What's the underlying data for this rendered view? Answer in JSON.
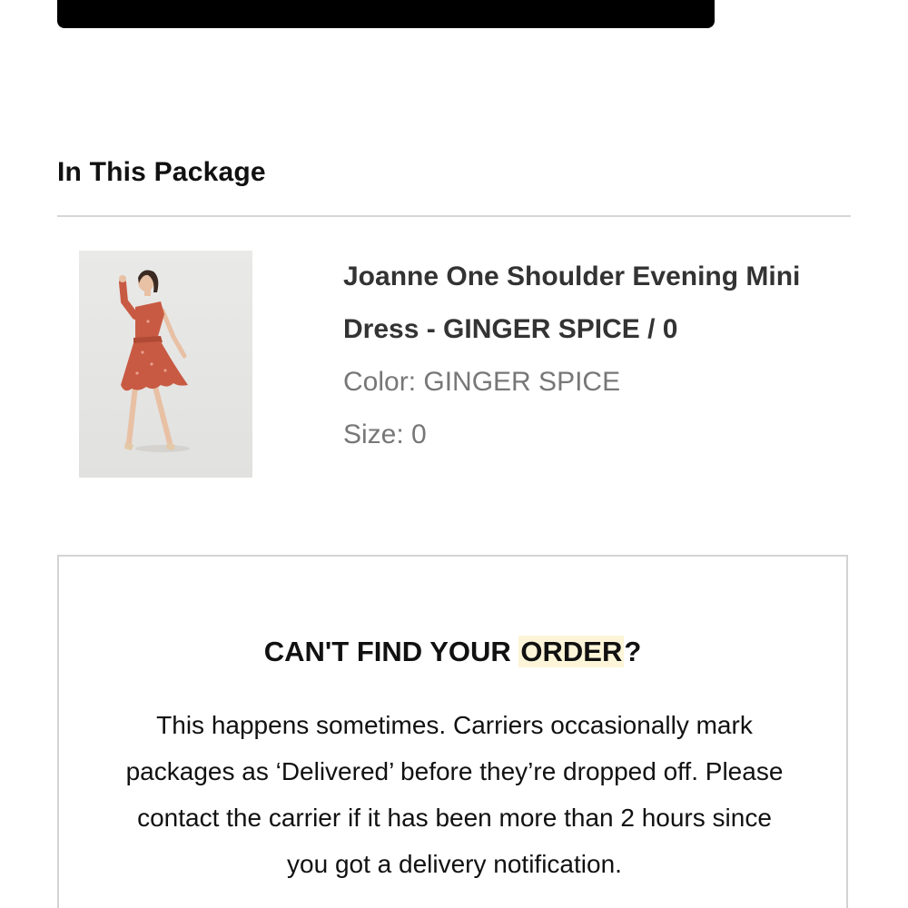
{
  "section": {
    "title": "In This Package"
  },
  "product": {
    "name": "Joanne One Shoulder Evening Mini Dress - GINGER SPICE / 0",
    "color_label": "Color:",
    "color_value": "GINGER SPICE",
    "size_label": "Size:",
    "size_value": "0",
    "image_icon": "dress-photo",
    "dress_color": "#c85a43"
  },
  "help": {
    "title_prefix": "CAN'T FIND YOUR ",
    "title_highlight": "ORDER",
    "title_suffix": "?",
    "highlight_color": "#fdf5d8",
    "body": "This happens sometimes. Carriers occasionally mark packages as ‘Delivered’ before they’re dropped off. Please contact the carrier if it has been more than 2 hours since you got a delivery notification."
  }
}
